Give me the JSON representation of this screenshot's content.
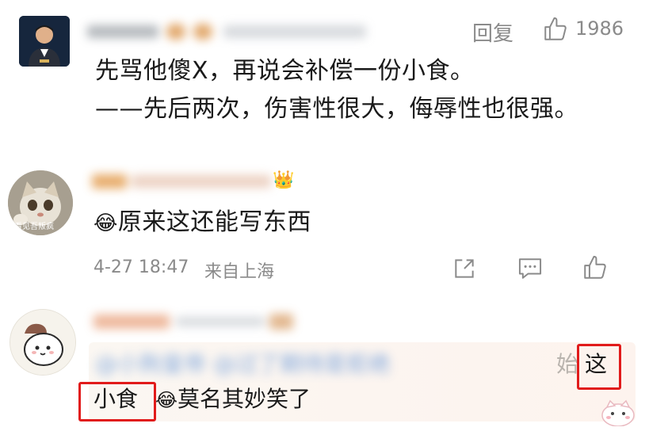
{
  "comment1": {
    "reply_label": "回复",
    "like_count": "1986",
    "lines": [
      "先骂他傻X，再说会补偿一份小食。",
      "——先后两次，伤害性很大，侮辱性也很强。"
    ]
  },
  "comment2": {
    "avatar_caption": "看见吾叛疯",
    "emoji": "😂",
    "text": "原来这还能写东西",
    "timestamp": "4-27 18:47",
    "location": "来自上海"
  },
  "comment3": {
    "blurred_text": "@小狗皇帝 @过了期待是拒绝",
    "partial_char": "始",
    "highlight_1": "这",
    "highlight_2": "小食",
    "emoji": "😂",
    "text_after": "莫名其妙笑了"
  },
  "colors": {
    "meta_gray": "#8a8a8a",
    "highlight_red": "#e11b1b"
  }
}
